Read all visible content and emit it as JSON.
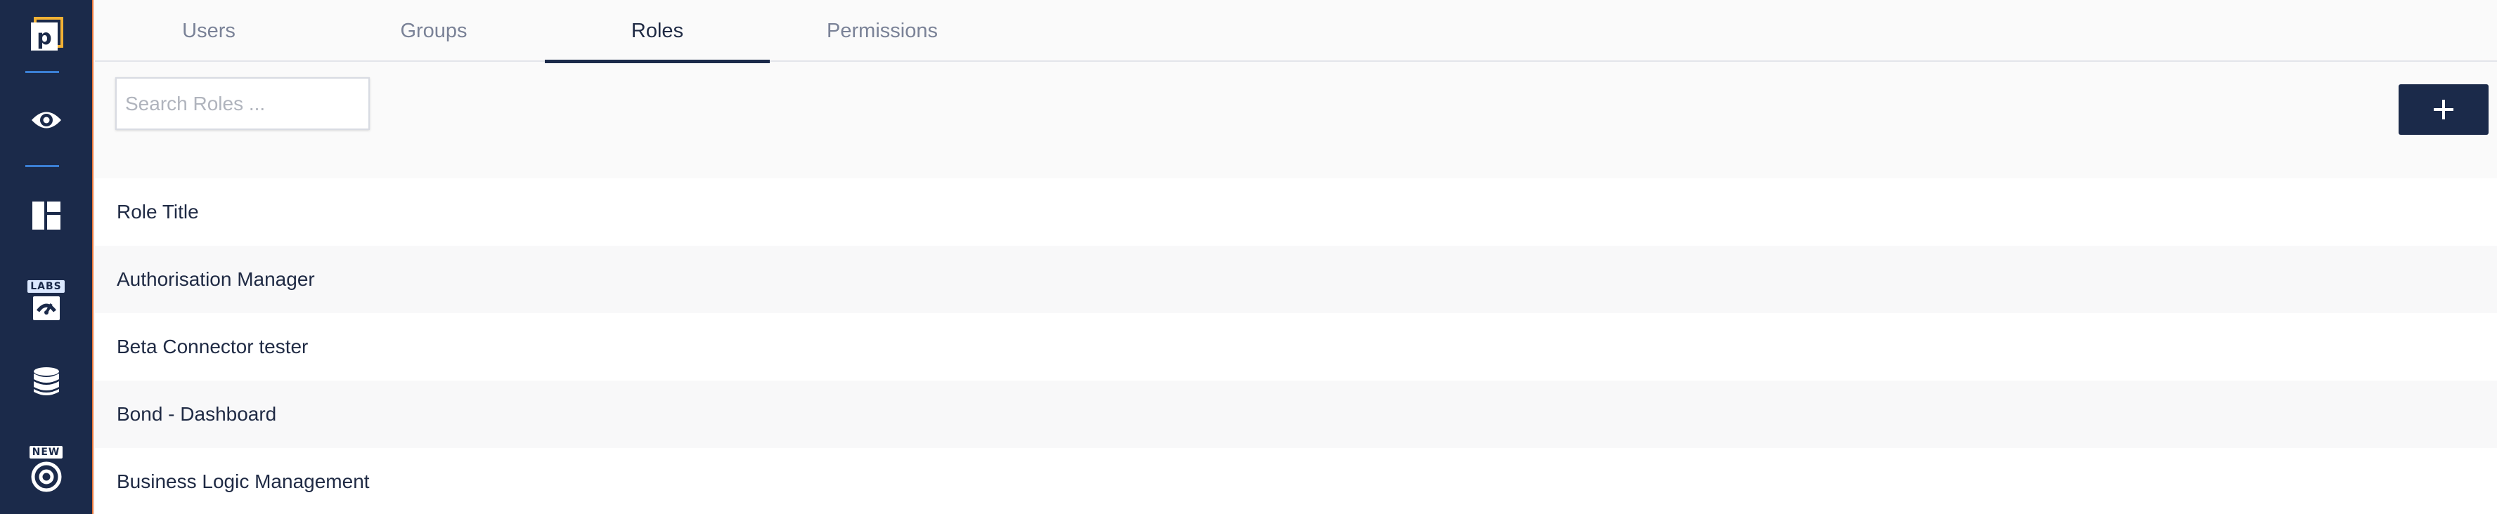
{
  "sidebar": {
    "logo_letter": "p",
    "labs_tag": "LABS",
    "new_tag": "NEW",
    "items": [
      {
        "icon": "eye-icon"
      },
      {
        "icon": "dashboard-layout-icon"
      },
      {
        "icon": "labs-gauge-icon"
      },
      {
        "icon": "database-icon"
      },
      {
        "icon": "target-icon"
      }
    ],
    "colors": {
      "background": "#1b2a4a",
      "separator": "#3b7fd4",
      "edge": "#e8763a"
    }
  },
  "tabs": [
    {
      "label": "Users",
      "active": false
    },
    {
      "label": "Groups",
      "active": false
    },
    {
      "label": "Roles",
      "active": true
    },
    {
      "label": "Permissions",
      "active": false
    }
  ],
  "search": {
    "placeholder": "Search Roles ...",
    "value": ""
  },
  "add_button": {
    "icon": "plus-icon"
  },
  "roles_table": {
    "header": "Role Title",
    "rows": [
      "Authorisation Manager",
      "Beta Connector tester",
      "Bond - Dashboard",
      "Business Logic Management"
    ]
  }
}
